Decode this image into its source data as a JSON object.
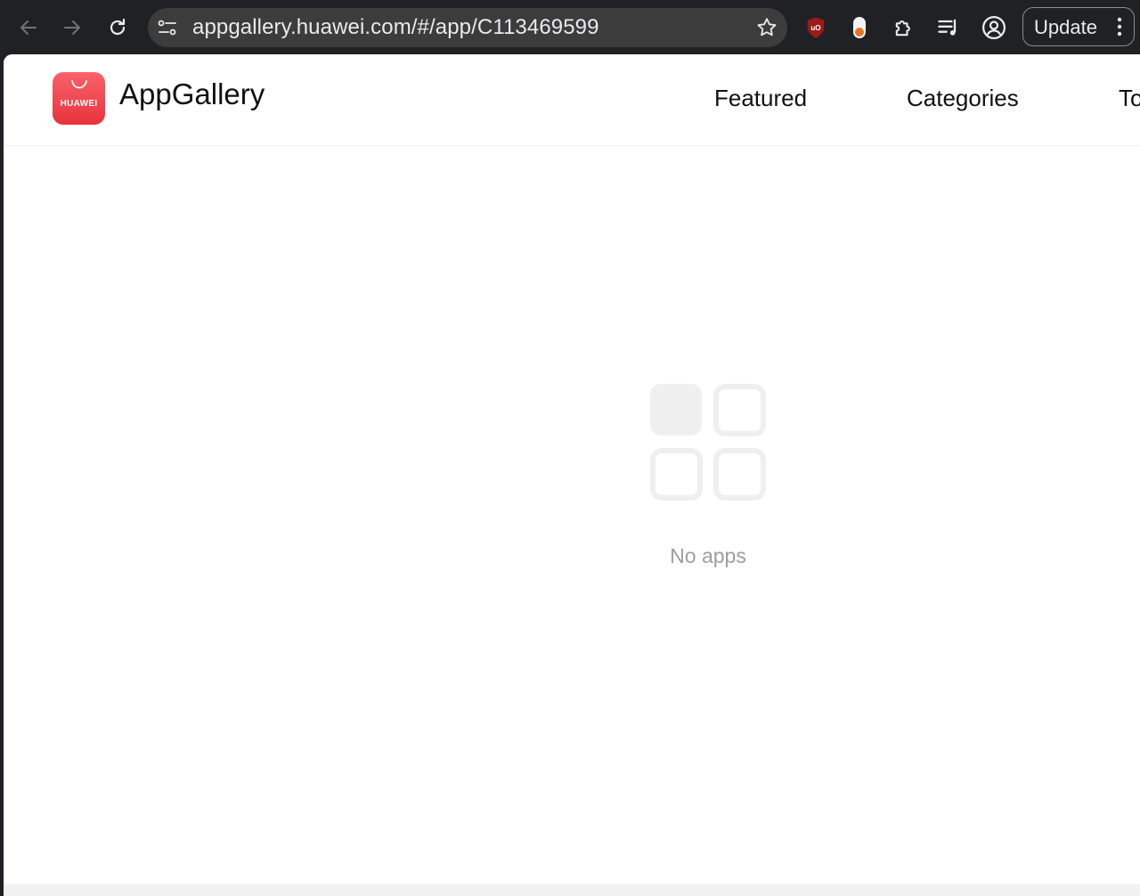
{
  "browser": {
    "url": "appgallery.huawei.com/#/app/C113469599",
    "update_label": "Update",
    "icons": {
      "back": "arrow-left-icon",
      "forward": "arrow-right-icon",
      "reload": "reload-icon",
      "site_settings": "tune-icon",
      "bookmark": "star-icon",
      "ublock": "ublock-shield-icon",
      "extension_orange": "pill-extension-icon",
      "extensions": "puzzle-icon",
      "media": "media-queue-icon",
      "profile": "profile-icon",
      "menu": "three-dots-icon"
    }
  },
  "header": {
    "logo_text": "HUAWEI",
    "app_name": "AppGallery",
    "nav": [
      "Featured",
      "Categories",
      "To"
    ]
  },
  "main": {
    "empty_text": "No apps"
  },
  "colors": {
    "toolbar_bg": "#202124",
    "omnibox_bg": "#3c3c3c",
    "logo_red": "#e8323d",
    "empty_text": "#9e9e9e"
  }
}
